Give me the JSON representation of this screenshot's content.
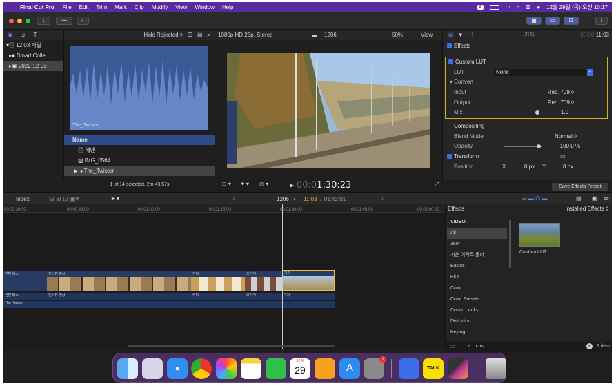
{
  "menubar": {
    "apple": "",
    "app_name": "Final Cut Pro",
    "items": [
      "File",
      "Edit",
      "Trim",
      "Mark",
      "Clip",
      "Modify",
      "View",
      "Window",
      "Help"
    ],
    "status_a": "A",
    "clock": "12월 29일 (목) 오전 10:17"
  },
  "library": {
    "items": [
      {
        "label": "12.03 파일"
      },
      {
        "label": "Smart Colle..."
      },
      {
        "label": "2022-12-03"
      }
    ]
  },
  "browser": {
    "hide_rejected": "Hide Rejected ◊",
    "clip_title": "The_Twister",
    "list_header": "Name",
    "rows": [
      "헤덴",
      "IMG_0564",
      "The_Twister"
    ],
    "status": "1 of 14 selected, 2m 43.57s"
  },
  "viewer": {
    "format": "1080p HD 25p, Stereo",
    "clip_number": "1206",
    "zoom": "50%",
    "view_label": "View",
    "timecode_dim": "00:0",
    "timecode": "1:30:23"
  },
  "inspector": {
    "clip_name": "기차",
    "duration_dim": "00:00:",
    "duration": "11:03",
    "effects_label": "Effects",
    "lut_section": "Custom LUT",
    "lut_label": "LUT",
    "lut_value": "None",
    "convert_label": "Convert",
    "input_label": "Input",
    "input_value": "Rec. 709 ◊",
    "output_label": "Output",
    "output_value": "Rec. 709 ◊",
    "mix_label": "Mix",
    "mix_value": "1.0",
    "compositing_label": "Compositing",
    "blend_label": "Blend Mode",
    "blend_value": "Normal ◊",
    "opacity_label": "Opacity",
    "opacity_value": "100.0 %",
    "transform_label": "Transform",
    "position_label": "Position",
    "pos_x_label": "X",
    "pos_x_value": "0 px",
    "pos_y_label": "Y",
    "pos_y_value": "0 px",
    "save_preset": "Save Effects Preset"
  },
  "timeline": {
    "index_label": "Index",
    "clip_number": "1206",
    "position": "11:03",
    "total": "01:42:01",
    "ruler": [
      "00:00:30:00",
      "00:00:45:00",
      "00:01:00:00",
      "00:01:15:00",
      "00:01:30:00",
      "00:01:45:00",
      "00:02:00:00"
    ],
    "clip_labels": [
      "천만 버스",
      "인터뷰 영상",
      "커피",
      "오가게",
      "기차"
    ],
    "audio_labels": [
      "천만 버스",
      "인터뷰 영상",
      "커피",
      "오가게",
      "기차"
    ],
    "bottom_track": "The_Twister"
  },
  "effects_browser": {
    "title": "Effects",
    "installed": "Installed Effects ◊",
    "categories": [
      "VIDEO",
      "All",
      "360°",
      "지은 이펙트 폴더",
      "Basics",
      "Blur",
      "Color",
      "Color Presets",
      "Comic Looks",
      "Distortion",
      "Keying"
    ],
    "result_name": "Custom LUT",
    "search_value": "cust",
    "count": "1 item"
  },
  "dock": {
    "calendar_month": "12월",
    "calendar_day": "29",
    "badge": "1"
  },
  "colors": {
    "menubar": "#5a2aa0",
    "accent": "#3b6ee8",
    "clip": "#283c63",
    "selected_clip_border": "#f0c030",
    "playhead": "#cccccc"
  }
}
